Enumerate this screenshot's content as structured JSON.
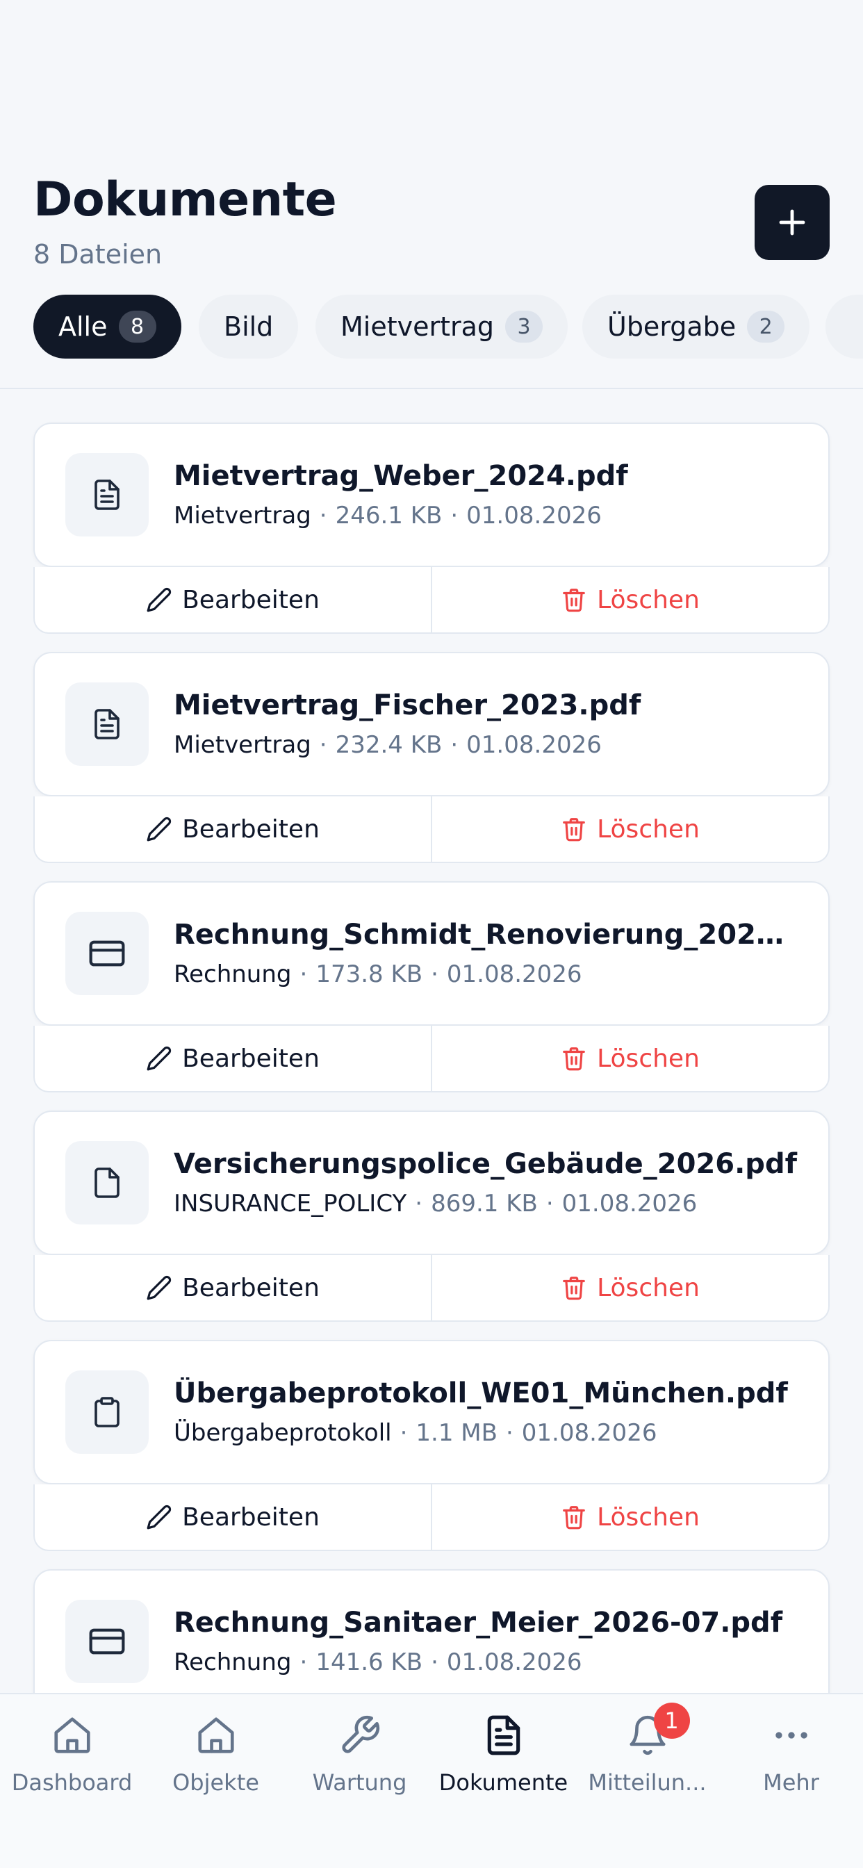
{
  "header": {
    "title": "Dokumente",
    "subtitle": "8 Dateien"
  },
  "filters": [
    {
      "label": "Alle",
      "count": "8",
      "active": true
    },
    {
      "label": "Bild",
      "count": null,
      "active": false
    },
    {
      "label": "Mietvertrag",
      "count": "3",
      "active": false
    },
    {
      "label": "Übergabe",
      "count": "2",
      "active": false
    }
  ],
  "documents": [
    {
      "name": "Mietvertrag_Weber_2024.pdf",
      "type": "Mietvertrag",
      "size": "246.1 KB",
      "date": "01.08.2026",
      "icon": "file-text-icon"
    },
    {
      "name": "Mietvertrag_Fischer_2023.pdf",
      "type": "Mietvertrag",
      "size": "232.4 KB",
      "date": "01.08.2026",
      "icon": "file-text-icon"
    },
    {
      "name": "Rechnung_Schmidt_Renovierung_2026-0...",
      "type": "Rechnung",
      "size": "173.8 KB",
      "date": "01.08.2026",
      "icon": "credit-card-icon"
    },
    {
      "name": "Versicherungspolice_Gebäude_2026.pdf",
      "type": "INSURANCE_POLICY",
      "size": "869.1 KB",
      "date": "01.08.2026",
      "icon": "file-icon"
    },
    {
      "name": "Übergabeprotokoll_WE01_München.pdf",
      "type": "Übergabeprotokoll",
      "size": "1.1 MB",
      "date": "01.08.2026",
      "icon": "clipboard-icon"
    },
    {
      "name": "Rechnung_Sanitaer_Meier_2026-07.pdf",
      "type": "Rechnung",
      "size": "141.6 KB",
      "date": "01.08.2026",
      "icon": "credit-card-icon"
    }
  ],
  "actions": {
    "edit_label": "Bearbeiten",
    "delete_label": "Löschen"
  },
  "nav": {
    "items": [
      {
        "label": "Dashboard",
        "icon": "home-icon"
      },
      {
        "label": "Objekte",
        "icon": "building-icon"
      },
      {
        "label": "Wartung",
        "icon": "wrench-icon"
      },
      {
        "label": "Dokumente",
        "icon": "document-icon"
      },
      {
        "label": "Mitteilun...",
        "icon": "bell-icon"
      },
      {
        "label": "Mehr",
        "icon": "more-icon"
      }
    ],
    "notification_badge": "1"
  },
  "colors": {
    "primary": "#111827",
    "danger": "#ef4444",
    "muted": "#64748b",
    "background": "#f5f7fa"
  }
}
